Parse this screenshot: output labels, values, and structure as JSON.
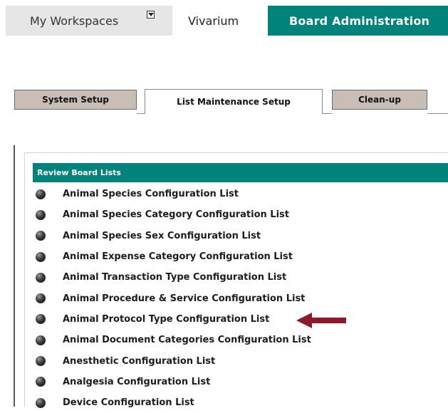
{
  "top_tabs": {
    "my_workspaces": "My Workspaces",
    "vivarium": "Vivarium",
    "board_admin": "Board Administration"
  },
  "sub_tabs": {
    "system_setup": "System Setup",
    "list_maintenance": "List Maintenance Setup",
    "clean_up": "Clean-up"
  },
  "panel": {
    "header": "Review Board Lists",
    "items": [
      {
        "label": "Animal Species Configuration List"
      },
      {
        "label": "Animal Species Category Configuration List"
      },
      {
        "label": "Animal Species Sex Configuration List"
      },
      {
        "label": "Animal Expense Category Configuration List"
      },
      {
        "label": "Animal Transaction Type Configuration List"
      },
      {
        "label": "Animal Procedure & Service Configuration List"
      },
      {
        "label": "Animal Protocol Type Configuration List"
      },
      {
        "label": "Animal Document Categories Configuration List"
      },
      {
        "label": "Anesthetic Configuration List"
      },
      {
        "label": "Analgesia Configuration List"
      },
      {
        "label": "Device Configuration List"
      }
    ]
  },
  "colors": {
    "accent": "#00837b",
    "tab_inactive": "#c9beb5",
    "arrow": "#8b1a2b"
  }
}
